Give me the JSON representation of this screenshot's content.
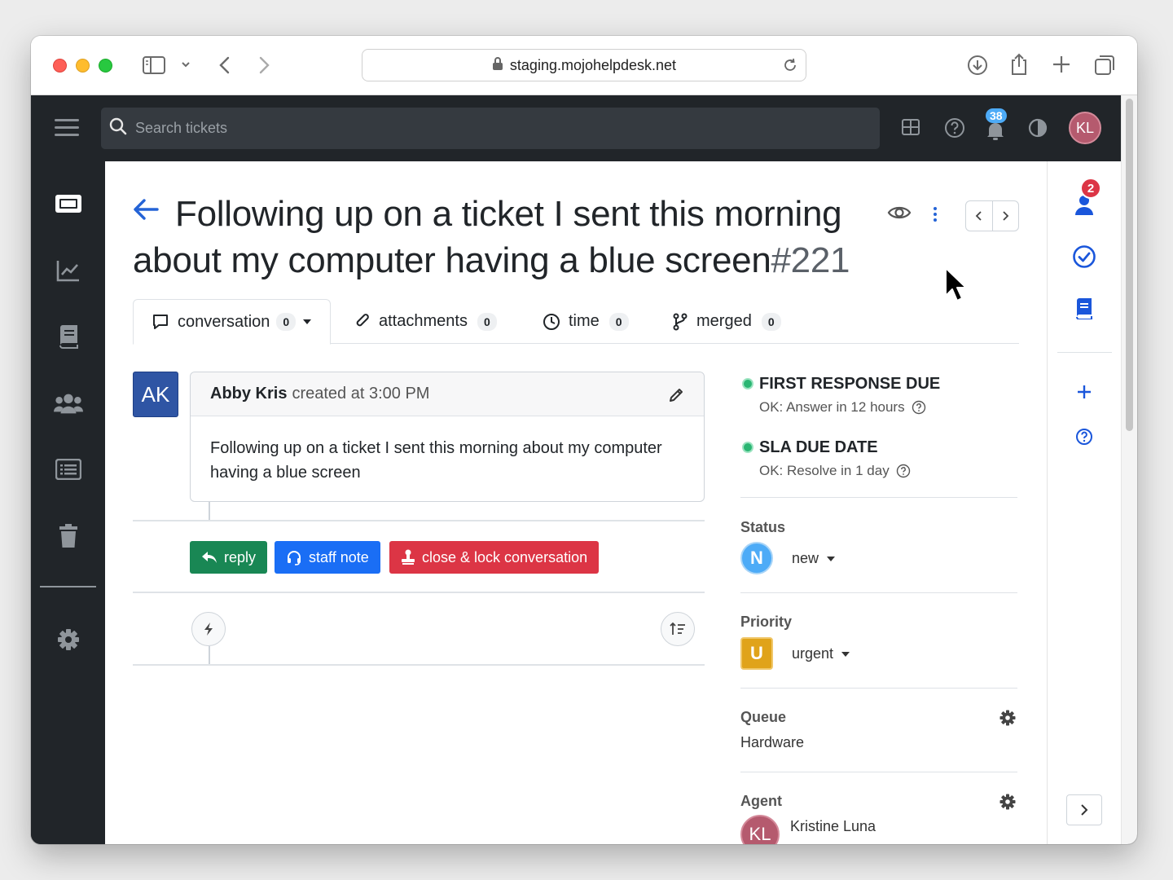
{
  "browser": {
    "url": "staging.mojohelpdesk.net"
  },
  "topnav": {
    "search_placeholder": "Search tickets",
    "notification_count": "38",
    "user_initials": "KL"
  },
  "ticket": {
    "title": "Following up on a ticket I sent this morning about my computer having a blue screen",
    "number": "#221"
  },
  "tabs": [
    {
      "label": "conversation",
      "count": "0"
    },
    {
      "label": "attachments",
      "count": "0"
    },
    {
      "label": "time",
      "count": "0"
    },
    {
      "label": "merged",
      "count": "0"
    }
  ],
  "message": {
    "avatar_initials": "AK",
    "author": "Abby Kris",
    "created": "created at 3:00 PM",
    "body": "Following up on a ticket I sent this morning about my computer having a blue screen"
  },
  "actions": {
    "reply": "reply",
    "staff_note": "staff note",
    "close_lock": "close & lock conversation"
  },
  "sla": [
    {
      "label": "FIRST RESPONSE DUE",
      "sub": "OK: Answer in 12 hours",
      "color": "#2bb673"
    },
    {
      "label": "SLA DUE DATE",
      "sub": "OK: Resolve in 1 day",
      "color": "#2bb673"
    }
  ],
  "status": {
    "label": "Status",
    "badge": "N",
    "value": "new",
    "color": "#4dabf7"
  },
  "priority": {
    "label": "Priority",
    "badge": "U",
    "value": "urgent",
    "color": "#e0a31a"
  },
  "queue": {
    "label": "Queue",
    "value": "Hardware"
  },
  "agent": {
    "label": "Agent",
    "initials": "KL",
    "name": "Kristine Luna"
  },
  "right_rail": {
    "contact_badge": "2"
  },
  "colors": {
    "accent": "#2463d6",
    "sidebar": "#212529",
    "reply": "#198754",
    "staff_note": "#1a6ef5",
    "close": "#dc3545"
  }
}
